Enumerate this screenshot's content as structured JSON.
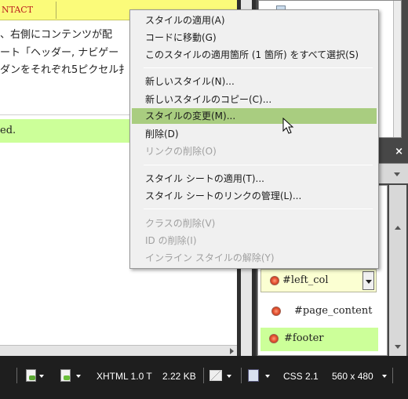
{
  "design_view": {
    "nav_item": "NTACT",
    "text_lines": [
      "、右側にコンテンツが配",
      "ート「ヘッダー, ナビゲー",
      "ダンをそれぞれ5ピクセル扌"
    ],
    "footer_text": "ed."
  },
  "context_menu": {
    "items": [
      {
        "label": "スタイルの適用(A)",
        "state": "normal"
      },
      {
        "label": "コードに移動(G)",
        "state": "normal"
      },
      {
        "label": "このスタイルの適用箇所 (1 箇所) をすべて選択(S)",
        "state": "normal"
      },
      {
        "label": "新しいスタイル(N)...",
        "state": "normal"
      },
      {
        "label": "新しいスタイルのコピー(C)...",
        "state": "normal"
      },
      {
        "label": "スタイルの変更(M)...",
        "state": "highlighted"
      },
      {
        "label": "削除(D)",
        "state": "normal"
      },
      {
        "label": "リンクの削除(O)",
        "state": "disabled"
      },
      {
        "label": "スタイル シートの適用(T)...",
        "state": "normal"
      },
      {
        "label": "スタイル シートのリンクの管理(L)...",
        "state": "normal"
      },
      {
        "label": "クラスの削除(V)",
        "state": "disabled"
      },
      {
        "label": "ID の削除(I)",
        "state": "disabled"
      },
      {
        "label": "インライン スタイルの解除(Y)",
        "state": "disabled"
      }
    ]
  },
  "panel": {
    "close_label": "×",
    "rules": [
      {
        "selector": "#left_col",
        "state": "selected"
      },
      {
        "selector": "#page_content",
        "state": "normal"
      },
      {
        "selector": "#footer",
        "state": "highlighted"
      }
    ]
  },
  "status_bar": {
    "doctype": "XHTML 1.0 T",
    "file_size": "2.22 KB",
    "css_version": "CSS 2.1",
    "page_size": "560 x 480"
  },
  "colors": {
    "menu_highlight": "#a9cd80",
    "footer_highlight": "#ccff99",
    "nav_bar": "#fbfb7a"
  },
  "icons": {
    "cursor": "arrow-pointer-icon",
    "rule_marker": "red-dot-icon",
    "dropdown": "chevron-down-icon"
  }
}
